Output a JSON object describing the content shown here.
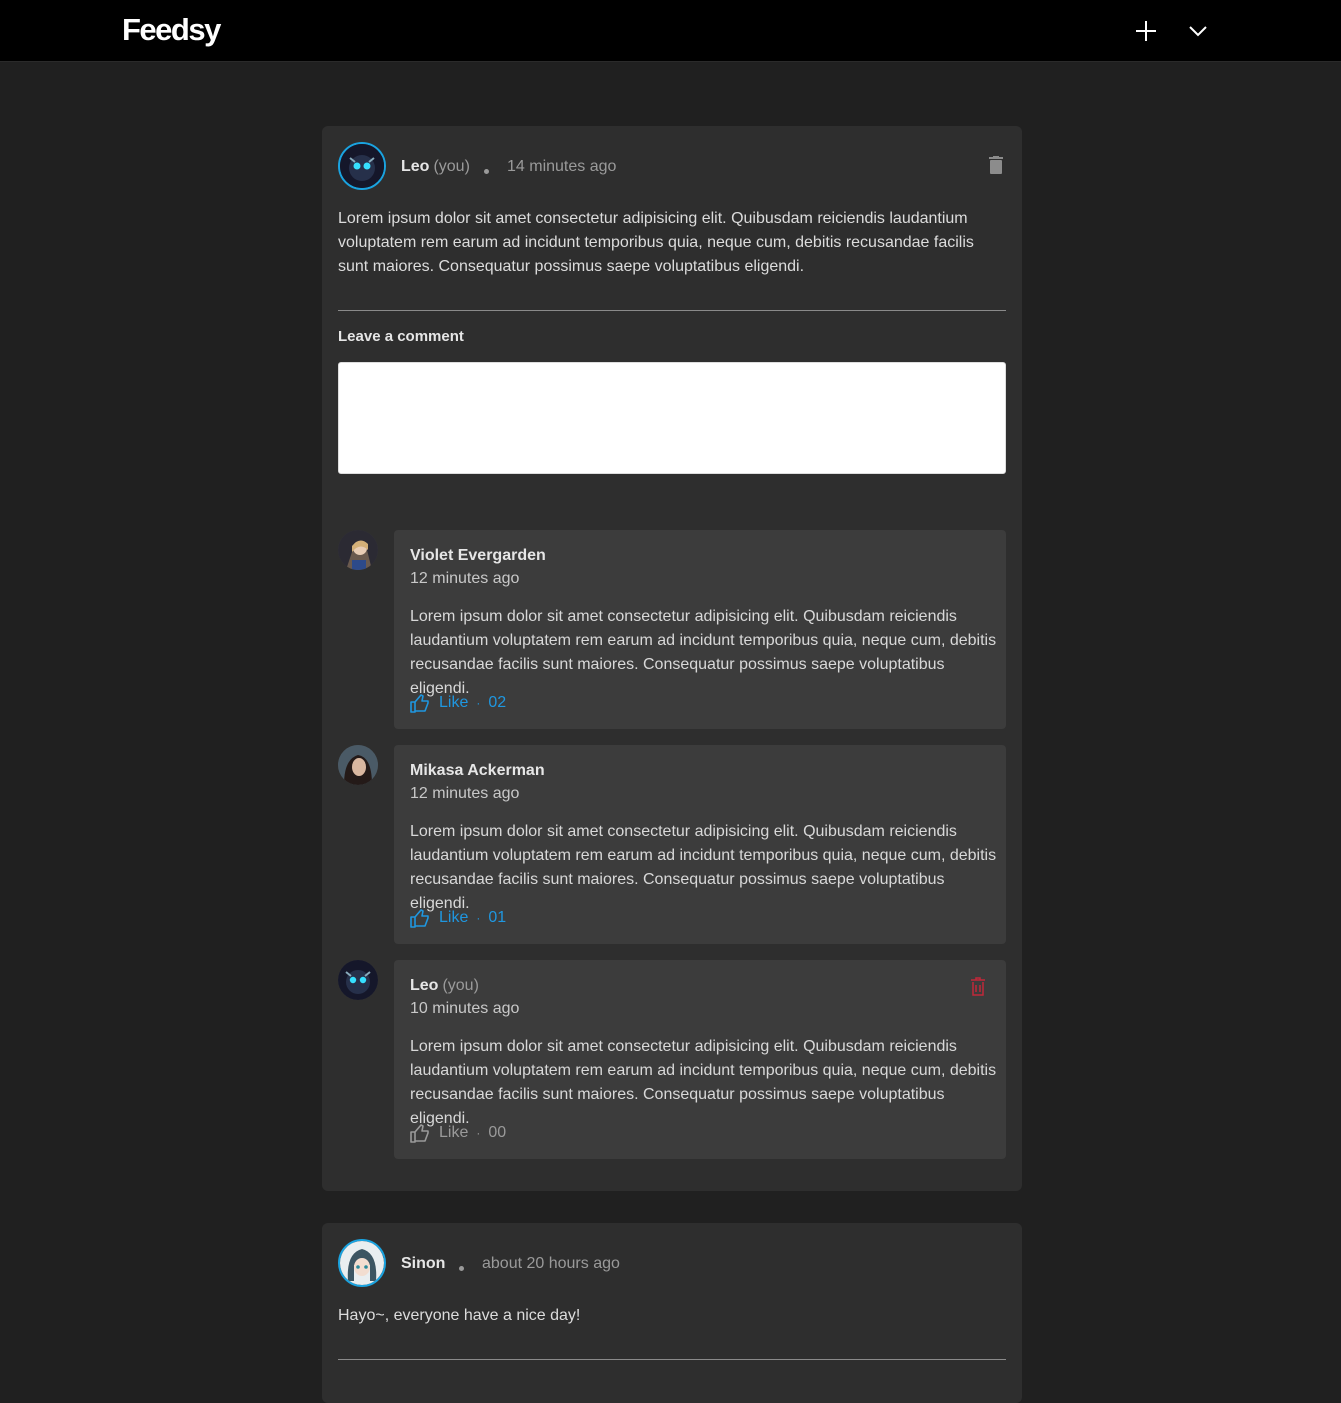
{
  "header": {
    "logo": "Feedsy",
    "add_icon": "plus-icon",
    "menu_icon": "chevron-down-icon"
  },
  "posts": [
    {
      "author": "Leo",
      "you_label": "(you)",
      "time": "14 minutes ago",
      "body": "Lorem ipsum dolor sit amet consectetur adipisicing elit. Quibusdam reiciendis laudantium voluptatem rem earum ad incidunt temporibus quia, neque cum, debitis recusandae facilis sunt maiores. Consequatur possimus saepe voluptatibus eligendi.",
      "comment_label": "Leave a comment",
      "comment_placeholder": "",
      "comments": [
        {
          "author": "Violet Evergarden",
          "you_label": "",
          "time": "12 minutes ago",
          "body": "Lorem ipsum dolor sit amet consectetur adipisicing elit. Quibusdam reiciendis laudantium voluptatem rem earum ad incidunt temporibus quia, neque cum, debitis recusandae facilis sunt maiores. Consequatur possimus saepe voluptatibus eligendi.",
          "like_label": "Like",
          "like_sep": "·",
          "like_count": "02",
          "liked": true
        },
        {
          "author": "Mikasa Ackerman",
          "you_label": "",
          "time": "12 minutes ago",
          "body": "Lorem ipsum dolor sit amet consectetur adipisicing elit. Quibusdam reiciendis laudantium voluptatem rem earum ad incidunt temporibus quia, neque cum, debitis recusandae facilis sunt maiores. Consequatur possimus saepe voluptatibus eligendi.",
          "like_label": "Like",
          "like_sep": "·",
          "like_count": "01",
          "liked": true
        },
        {
          "author": "Leo",
          "you_label": "(you)",
          "time": "10 minutes ago",
          "body": "Lorem ipsum dolor sit amet consectetur adipisicing elit. Quibusdam reiciendis laudantium voluptatem rem earum ad incidunt temporibus quia, neque cum, debitis recusandae facilis sunt maiores. Consequatur possimus saepe voluptatibus eligendi.",
          "like_label": "Like",
          "like_sep": "·",
          "like_count": "00",
          "liked": false
        }
      ]
    },
    {
      "author": "Sinon",
      "time": "about 20 hours ago",
      "body": "Hayo~, everyone have a nice day!"
    }
  ],
  "colors": {
    "accent": "#1aa3e0",
    "like": "#1f97e0",
    "delete_red": "#c0283a",
    "card": "#2e2e2e",
    "comment_box": "#3c3c3c"
  }
}
